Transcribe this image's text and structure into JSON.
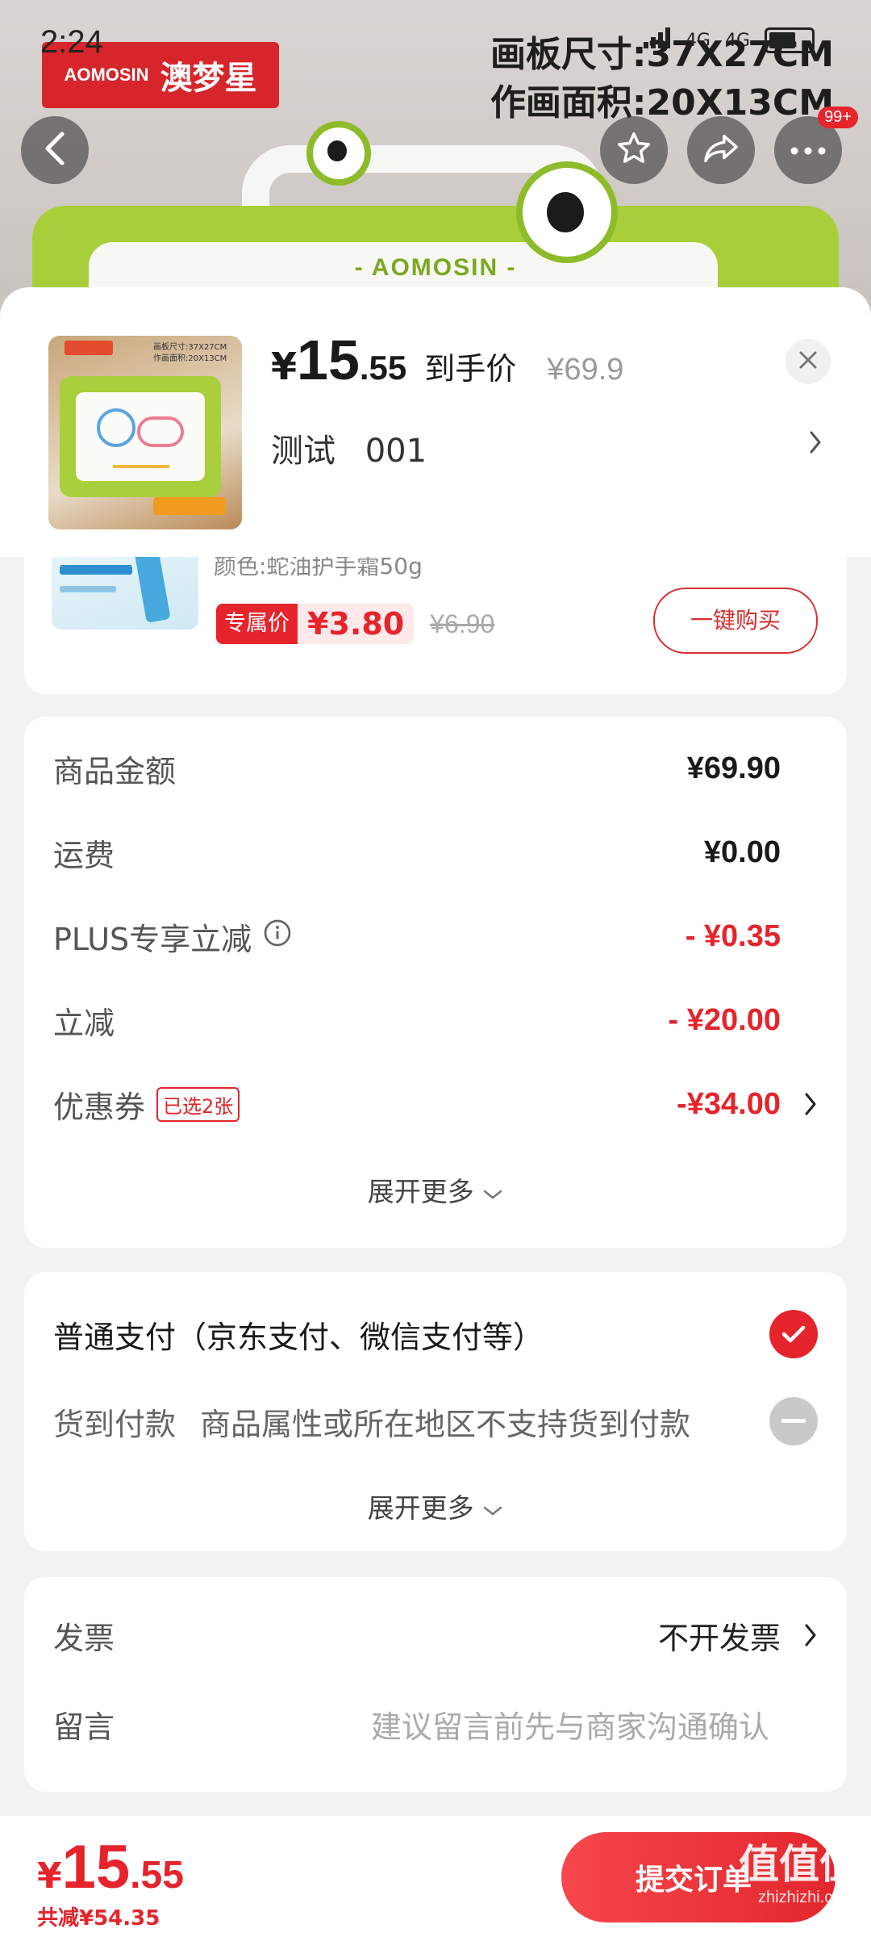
{
  "status_bar": {
    "time": "2:24",
    "network_1": "4G",
    "network_2": "4G"
  },
  "hero": {
    "brand_en": "AOMOSIN",
    "brand_cn": "澳梦星",
    "board_brand": "- AOMOSIN -",
    "spec_line_1": "画板尺寸:37X27CM",
    "spec_line_2": "作画面积:20X13CM",
    "more_badge": "99+"
  },
  "product": {
    "price_symbol": "¥",
    "price_int": "15",
    "price_dec": ".55",
    "price_label": "到手价",
    "original_price": "¥69.9",
    "variant_label": "测试",
    "variant_value": "001",
    "thumb_spec_1": "画板尺寸:37X27CM",
    "thumb_spec_2": "作画面积:20X13CM"
  },
  "addon": {
    "cut_text": "颜色:蛇油护手霜50g",
    "tag_label": "专属价",
    "price": "¥3.80",
    "original_price": "¥6.90",
    "buy_label": "一键购买"
  },
  "summary": {
    "rows": [
      {
        "label": "商品金额",
        "value": "¥69.90"
      },
      {
        "label": "运费",
        "value": "¥0.00"
      },
      {
        "label": "PLUS专享立减",
        "value": "- ¥0.35"
      },
      {
        "label": "立减",
        "value": "- ¥20.00"
      },
      {
        "label": "优惠券",
        "value": "-¥34.00",
        "tag": "已选2张"
      }
    ],
    "expand_label": "展开更多"
  },
  "payment": {
    "normal_label": "普通支付（京东支付、微信支付等）",
    "cod_label": "货到付款",
    "cod_note": "商品属性或所在地区不支持货到付款",
    "expand_label": "展开更多"
  },
  "extra": {
    "invoice_label": "发票",
    "invoice_value": "不开发票",
    "note_label": "留言",
    "note_placeholder": "建议留言前先与商家沟通确认"
  },
  "bottom": {
    "yen": "¥",
    "total_int": "15",
    "total_dec": ".55",
    "saved": "共减¥54.35",
    "submit_label": "提交订单"
  },
  "watermark": {
    "logo": "值值值",
    "site": "zhizhizhi.com"
  },
  "colors": {
    "accent": "#e5242c",
    "background": "#f2f2f2",
    "card": "#ffffff"
  }
}
